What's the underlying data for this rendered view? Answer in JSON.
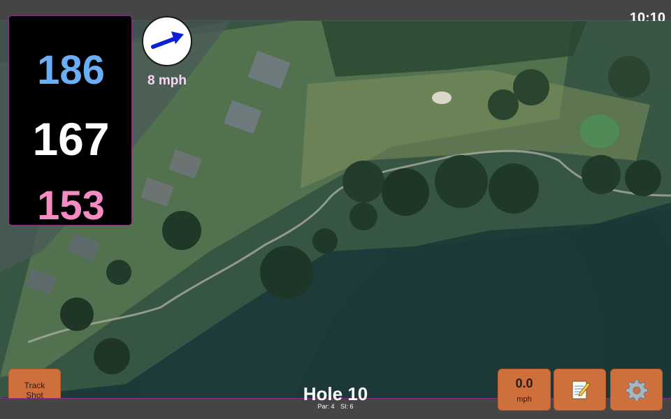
{
  "status": {
    "clock": "10:10"
  },
  "distances": {
    "back": "186",
    "middle": "167",
    "front": "153"
  },
  "wind": {
    "speed": "8 mph",
    "icon": "wind-arrow-icon"
  },
  "buttons": {
    "track_shot_line1": "Track",
    "track_shot_line2": "Shot",
    "speed_value": "0.0",
    "speed_unit": "mph",
    "notes_icon": "notepad-icon",
    "settings_icon": "gear-icon"
  },
  "hole": {
    "title": "Hole 10",
    "par": "Par: 4",
    "si": "SI: 6"
  },
  "colors": {
    "back_distance": "#6aaef7",
    "middle_distance": "#ffffff",
    "front_distance": "#f48bc3",
    "button": "#cf6f3c",
    "accent_border": "#8a2f86",
    "wind_arrow": "#0a1fd8"
  }
}
